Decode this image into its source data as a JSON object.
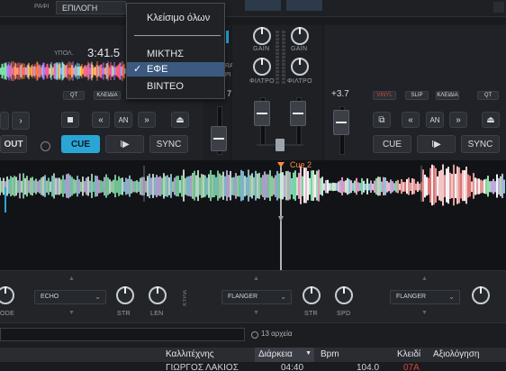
{
  "topbar": {
    "left_label": "PAΦI",
    "dropdown_label": "ΕΠΙΛΟΓΗ"
  },
  "menu": {
    "close_all": "Κλείσιμο όλων",
    "items": [
      {
        "label": "ΜΙΚΤΗΣ",
        "checked": false
      },
      {
        "label": "ΕΦΕ",
        "checked": true
      },
      {
        "label": "ΒΙΝΤΕΟ",
        "checked": false
      }
    ],
    "check_glyph": "✓"
  },
  "deck_left": {
    "time_label": "ΥΠΟΛ.",
    "time_value": "3:41.5",
    "small_buttons": [
      "QT",
      "ΚΛΕΙΔΙΑ"
    ],
    "cue_label": "CUE",
    "sync_label": "SYNC",
    "out_label": "OUT",
    "an_label": "AN",
    "play_glyph": "I▶",
    "nav_prev": "«",
    "nav_next": "»",
    "eject_glyph": "⏏"
  },
  "mixer": {
    "gain_label": "GAIN",
    "filter_label": "ΦΙΛΤΡΟ",
    "left_pitch_value": "7",
    "eq_left_label": "RA",
    "eq_left_label2": "ΡΙ"
  },
  "deck_right": {
    "pitch_value": "+3.7",
    "small_buttons": [
      "VINYL",
      "SLIP",
      "ΚΛΕΙΔΙΑ",
      "QT"
    ],
    "cue_label": "CUE",
    "sync_label": "SYNC",
    "an_label": "AN",
    "play_glyph": "I▶",
    "nav_prev": "«",
    "nav_next": "»",
    "eject_glyph": "⏏",
    "loop_glyph": "⧉"
  },
  "waveform": {
    "cue_label": "Cue 2"
  },
  "fx": {
    "left": {
      "effect": "ECHO",
      "knob1": "STR",
      "knob2": "LEN",
      "cut_label": "ODE"
    },
    "center_side_label": "ΚΥΡΙΑ",
    "mid": {
      "effect": "FLANGER",
      "knob1": "STR",
      "knob2": "SPD"
    },
    "right": {
      "effect": "FLANGER"
    }
  },
  "browser": {
    "file_count": "13 αρχεία",
    "columns": [
      "Καλλιτέχνης",
      "Διάρκεια",
      "Bpm",
      "Κλειδί",
      "Αξιολόγηση"
    ],
    "sort_glyph": "▼",
    "row": {
      "artist": "ΓΙΩΡΓΟΣ ΛΑΚΙΟΣ",
      "duration": "04:40",
      "bpm": "104.0",
      "key": "07A"
    }
  },
  "colors": {
    "accent": "#2aa6d6",
    "cue_orange": "#ff8a3d",
    "vinyl_red": "#d8443a"
  }
}
